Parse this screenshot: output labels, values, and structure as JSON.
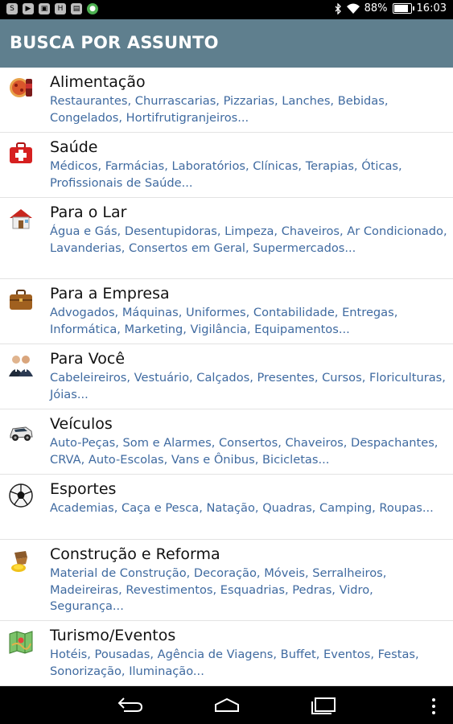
{
  "status_bar": {
    "battery": "88%",
    "time": "16:03",
    "icons": [
      "skype-icon",
      "youtube-icon",
      "image-icon",
      "hd-icon",
      "photo-icon",
      "phone-app-icon",
      "bluetooth-icon",
      "wifi-icon",
      "battery-icon"
    ],
    "battery_level": 0.88
  },
  "app_bar": {
    "title": "BUSCA POR ASSUNTO",
    "color": "#5f7f8e"
  },
  "categories": [
    {
      "title": "Alimentação",
      "desc": "Restaurantes, Churrascarias, Pizzarias, Lanches, Bebidas, Congelados, Hortifrutigranjeiros...",
      "icon": "food-icon"
    },
    {
      "title": "Saúde",
      "desc": "Médicos, Farmácias, Laboratórios, Clínicas, Terapias, Óticas, Profissionais de Saúde...",
      "icon": "first-aid-kit-icon"
    },
    {
      "title": "Para o Lar",
      "desc": "Água e Gás, Desentupidoras, Limpeza, Chaveiros, Ar Condicionado, Lavanderias, Consertos em Geral, Supermercados...",
      "icon": "house-icon"
    },
    {
      "title": "Para a Empresa",
      "desc": "Advogados, Máquinas, Uniformes, Contabilidade, Entregas, Informática, Marketing, Vigilância, Equipamentos...",
      "icon": "briefcase-icon"
    },
    {
      "title": "Para Você",
      "desc": "Cabeleireiros, Vestuário, Calçados, Presentes, Cursos, Floriculturas, Jóias...",
      "icon": "people-icon"
    },
    {
      "title": "Veículos",
      "desc": "Auto-Peças, Som e Alarmes, Consertos, Chaveiros, Despachantes, CRVA, Auto-Escolas, Vans e Ônibus, Bicicletas...",
      "icon": "car-icon"
    },
    {
      "title": "Esportes",
      "desc": "Academias, Caça e Pesca, Natação, Quadras, Camping, Roupas...",
      "icon": "soccer-ball-icon"
    },
    {
      "title": "Construção e Reforma",
      "desc": "Material de Construção, Decoração, Móveis, Serralheiros, Madeireiras, Revestimentos, Esquadrias, Pedras, Vidro, Segurança...",
      "icon": "paint-bucket-icon"
    },
    {
      "title": "Turismo/Eventos",
      "desc": "Hotéis, Pousadas, Agência de Viagens, Buffet, Eventos, Festas, Sonorização, Iluminação...",
      "icon": "map-icon"
    }
  ],
  "nav_bar": {
    "icons": [
      "back-icon",
      "home-icon",
      "recent-apps-icon",
      "overflow-menu-icon"
    ]
  }
}
